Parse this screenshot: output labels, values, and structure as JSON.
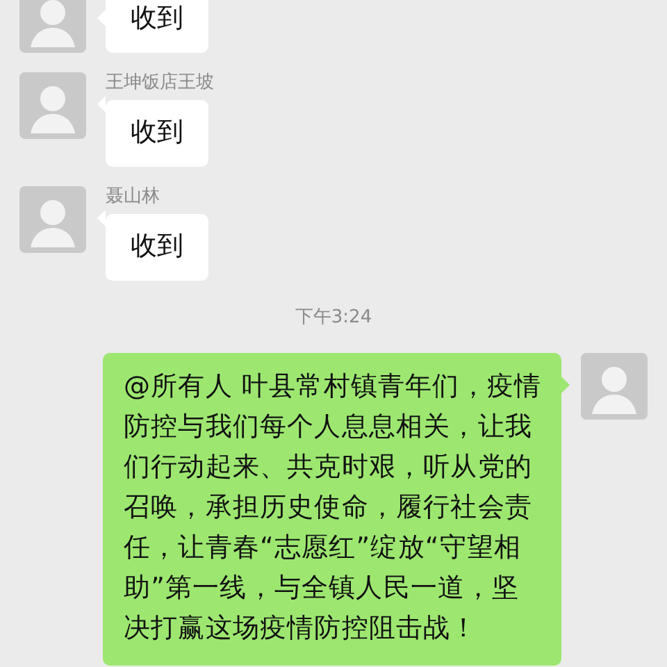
{
  "messages": [
    {
      "kind": "incoming",
      "text": "收到"
    },
    {
      "kind": "incoming",
      "sender": "王坤饭店王坡",
      "text": "收到"
    },
    {
      "kind": "incoming",
      "sender": "聂山林",
      "text": "收到"
    },
    {
      "kind": "time",
      "text": "下午3:24"
    },
    {
      "kind": "outgoing",
      "text": "@所有人  叶县常村镇青年们，疫情防控与我们每个人息息相关，让我们行动起来、共克时艰，听从党的召唤，承担历史使命，履行社会责任，让青春“志愿红”绽放“守望相助”第一线，与全镇人民一道，坚决打赢这场疫情防控阻击战！"
    }
  ]
}
